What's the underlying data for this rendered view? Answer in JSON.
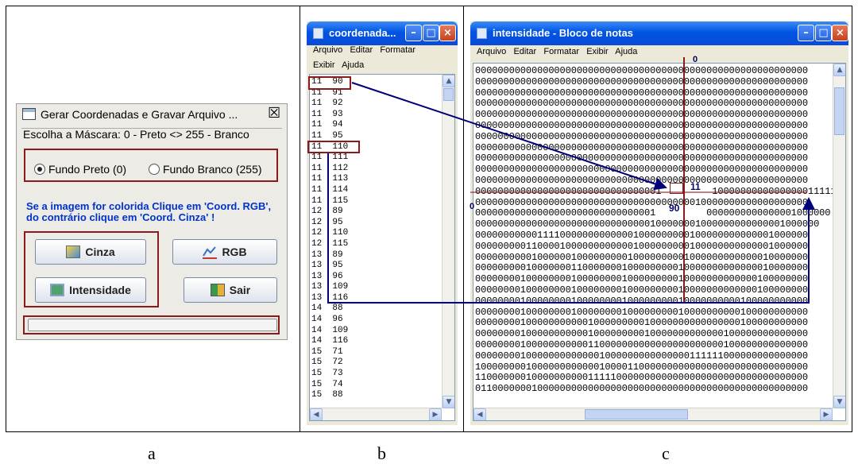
{
  "captions": {
    "a": "a",
    "b": "b",
    "c": "c"
  },
  "panel_a": {
    "title": "Gerar Coordenadas e Gravar Arquivo ...",
    "close_glyph": "☒",
    "mask_label": "Escolha a Máscara: 0 - Preto <> 255 - Branco",
    "radio_black": "Fundo Preto (0)",
    "radio_white": "Fundo Branco (255)",
    "radio_black_selected": true,
    "hint": "Se a imagem for colorida Clique em 'Coord. RGB', do contrário clique em 'Coord. Cinza' !",
    "hint_color": "#0033cc",
    "buttons": {
      "cinza": "Cinza",
      "rgb": "RGB",
      "intensidade": "Intensidade",
      "sair": "Sair"
    },
    "highlight_color": "#8b1a1a"
  },
  "panel_b": {
    "title": "coordenada...",
    "menu": {
      "arquivo": "Arquivo",
      "editar": "Editar",
      "formatar": "Formatar",
      "exibir": "Exibir",
      "ajuda": "Ajuda"
    },
    "rows": [
      [
        "11",
        "90"
      ],
      [
        "11",
        "91"
      ],
      [
        "11",
        "92"
      ],
      [
        "11",
        "93"
      ],
      [
        "11",
        "94"
      ],
      [
        "11",
        "95"
      ],
      [
        "11",
        "110"
      ],
      [
        "11",
        "111"
      ],
      [
        "11",
        "112"
      ],
      [
        "11",
        "113"
      ],
      [
        "11",
        "114"
      ],
      [
        "11",
        "115"
      ],
      [
        "12",
        "89"
      ],
      [
        "12",
        "95"
      ],
      [
        "12",
        "110"
      ],
      [
        "12",
        "115"
      ],
      [
        "13",
        "89"
      ],
      [
        "13",
        "95"
      ],
      [
        "13",
        "96"
      ],
      [
        "13",
        "109"
      ],
      [
        "13",
        "116"
      ],
      [
        "14",
        "88"
      ],
      [
        "14",
        "96"
      ],
      [
        "14",
        "109"
      ],
      [
        "14",
        "116"
      ],
      [
        "15",
        "71"
      ],
      [
        "15",
        "72"
      ],
      [
        "15",
        "73"
      ],
      [
        "15",
        "74"
      ],
      [
        "15",
        "88"
      ]
    ]
  },
  "panel_c": {
    "title": "intensidade - Bloco de notas",
    "menu": {
      "arquivo": "Arquivo",
      "editar": "Editar",
      "formatar": "Formatar",
      "exibir": "Exibir",
      "ajuda": "Ajuda"
    },
    "marker_top": "0",
    "marker_left": "0",
    "marker_col": "90",
    "marker_row": "11",
    "lines": [
      "00000000000000000000000000000000000000000000000000000000000",
      "00000000000000000000000000000000000000000000000000000000000",
      "00000000000000000000000000000000000000000000000000000000000",
      "00000000000000000000000000000000000000000000000000000000000",
      "00000000000000000000000000000000000000000000000000000000000",
      "00000000000000000000000000000000000000000000000000000000000",
      "00000000000000000000000000000000000000000000000000000000000",
      "00000000000000000000000000000000000000000000000000000000000",
      "00000000000000000000000000000000000000000000000000000000000",
      "00000000000000000000000000000000000000000000000000000000000",
      "00000000000000000000000000000000000000000000000000000000000",
      "000000000000000000000000000000001         1000000000000000011111",
      "00000000000000000000000000000000000000010000000000000000000",
      "00000000000000000000000000000001         0000000000000001000000",
      "0000000000000000000000000000000100000001000000000000001000000",
      "00000000000111100000000000001000000000100000000000001000000",
      "00000000011000010000000000001000000000100000000000001000000",
      "00000000001000000100000000010000000001000000000000010000000",
      "00000000010000000110000000100000000010000000000000010000000",
      "00000000100000000100000000100000000010000000000000100000000",
      "00000000100000000100000000100000000010000000000000100000000",
      "00000000100000000100000000100000000010000000000100000000000",
      "00000000100000000100000000100000000010000000000100000000000",
      "00000000100000000000100000000010000000000000000100000000000",
      "00000000100000000000100000000010000000000000100000000000000",
      "00000000100000000000110000000000000000000000100000000000000",
      "00000000100000000000001000000000000000111111000000000000000",
      "10000000010000000000001000011000000000000000000000000000000",
      "11000000010000000000111110000000000000000000000000000000000",
      "01100000001000000000000000000000000000000000000000000000000"
    ]
  }
}
